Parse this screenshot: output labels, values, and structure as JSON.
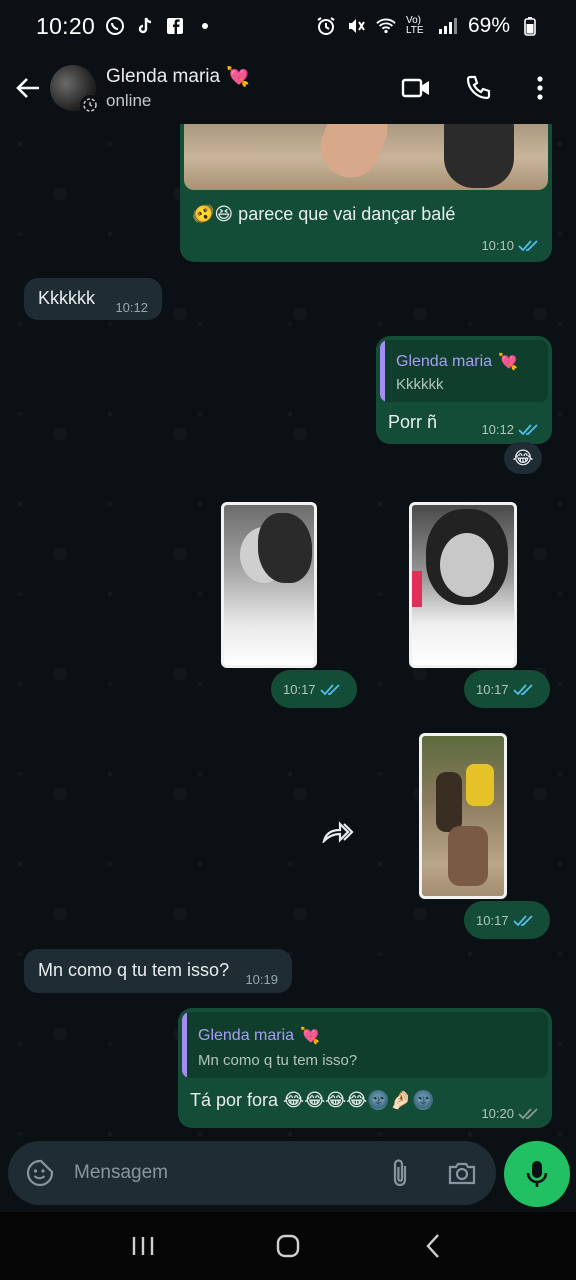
{
  "status_bar": {
    "time": "10:20",
    "battery": "69%",
    "network": "Vo) LTE"
  },
  "header": {
    "contact_name": "Glenda maria",
    "contact_emoji": "💘",
    "status": "online"
  },
  "messages": [
    {
      "id": "m1",
      "direction": "out",
      "text": "🫨😆 parece que vai dançar balé",
      "time": "10:10",
      "read": true
    },
    {
      "id": "m2",
      "direction": "in",
      "text": "Kkkkkk",
      "time": "10:12"
    },
    {
      "id": "m3",
      "direction": "out",
      "quote_name": "Glenda maria",
      "quote_text": "Kkkkkk",
      "text": "Porr ñ",
      "time": "10:12",
      "read": true,
      "reaction": "😂"
    },
    {
      "id": "m4",
      "direction": "out",
      "type": "image",
      "time": "10:17",
      "read": true
    },
    {
      "id": "m5",
      "direction": "out",
      "type": "image",
      "time": "10:17",
      "read": true
    },
    {
      "id": "m6",
      "direction": "out",
      "type": "image",
      "time": "10:17",
      "read": true
    },
    {
      "id": "m7",
      "direction": "in",
      "text": "Mn como q tu tem isso?",
      "time": "10:19"
    },
    {
      "id": "m8",
      "direction": "out",
      "quote_name": "Glenda maria",
      "quote_text": "Mn como q tu tem isso?",
      "text": "Tá por fora 😂😂😂😂🌚🤌🏻🌚",
      "time": "10:20",
      "read": false
    }
  ],
  "input": {
    "placeholder": "Mensagem"
  },
  "colors": {
    "outgoing_bubble": "#134d37",
    "incoming_bubble": "#1f2c34",
    "read_ticks": "#53bdeb",
    "accent_green": "#21c063"
  }
}
